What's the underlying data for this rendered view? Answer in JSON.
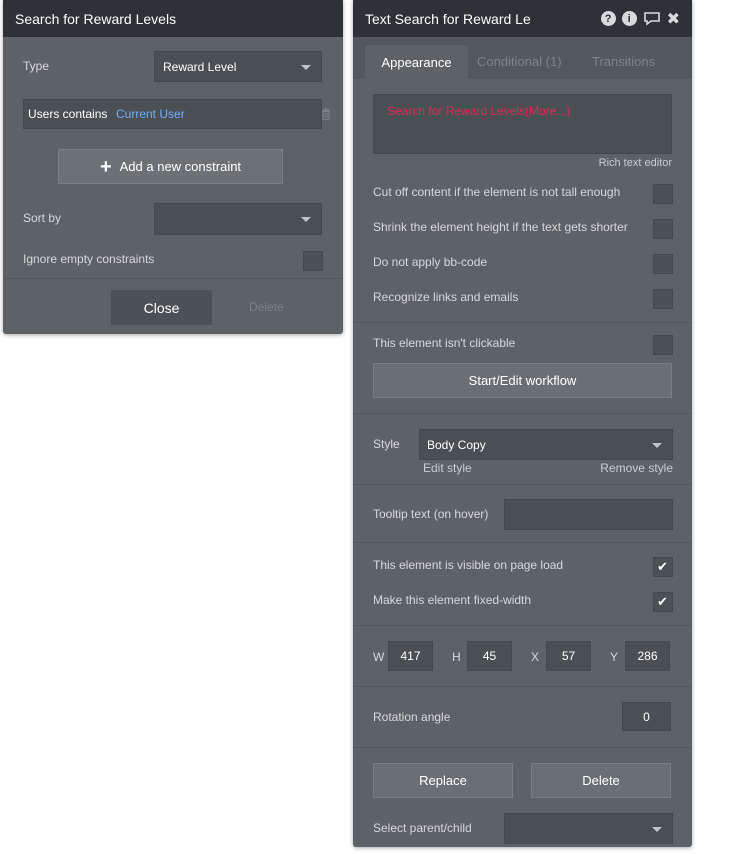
{
  "search_panel": {
    "title": "Search for Reward Levels",
    "type_label": "Type",
    "type_value": "Reward Level",
    "constraint_prefix": "Users contains",
    "constraint_value": "Current User",
    "add_constraint_label": "Add a new constraint",
    "sort_by_label": "Sort by",
    "sort_by_value": "",
    "ignore_empty_label": "Ignore empty constraints",
    "close_label": "Close",
    "delete_label": "Delete"
  },
  "property_panel": {
    "title": "Text Search for Reward Le",
    "tabs": [
      {
        "label": "Appearance"
      },
      {
        "label": "Conditional (1)"
      },
      {
        "label": "Transitions"
      }
    ],
    "content_text": "Search for Reward Levels(More...)",
    "rich_text_link": "Rich text editor",
    "checks": [
      {
        "label": "Cut off content if the element is not tall enough",
        "checked": false
      },
      {
        "label": "Shrink the element height if the text gets shorter",
        "checked": false
      },
      {
        "label": "Do not apply bb-code",
        "checked": false
      },
      {
        "label": "Recognize links and emails",
        "checked": false
      }
    ],
    "not_clickable_label": "This element isn't clickable",
    "workflow_button": "Start/Edit workflow",
    "style_label": "Style",
    "style_value": "Body Copy",
    "edit_style": "Edit style",
    "remove_style": "Remove style",
    "tooltip_label": "Tooltip text (on hover)",
    "visible_label": "This element is visible on page load",
    "visible_checked": true,
    "fixed_width_label": "Make this element fixed-width",
    "fixed_width_checked": true,
    "dims": {
      "w_label": "W",
      "w": "417",
      "h_label": "H",
      "h": "45",
      "x_label": "X",
      "x": "57",
      "y_label": "Y",
      "y": "286"
    },
    "rotation_label": "Rotation angle",
    "rotation_value": "0",
    "replace_label": "Replace",
    "delete_label": "Delete",
    "select_parent_label": "Select parent/child",
    "checkmark": "✔",
    "accent_red": "#e0264f",
    "accent_blue": "#6fb0ff"
  }
}
